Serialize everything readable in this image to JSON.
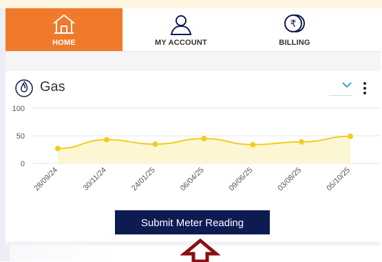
{
  "nav": {
    "tabs": [
      {
        "label": "HOME",
        "icon": "home-icon",
        "active": true
      },
      {
        "label": "MY ACCOUNT",
        "icon": "user-icon",
        "active": false
      },
      {
        "label": "BILLING",
        "icon": "rupee-icon",
        "active": false
      }
    ],
    "accent": "#f07a2a"
  },
  "card": {
    "title": "Gas",
    "icon": "flame-icon"
  },
  "chart_data": {
    "type": "area",
    "categories": [
      "28/09/24",
      "30/11/24",
      "24/01/25",
      "06/04/25",
      "09/06/25",
      "03/08/25",
      "05/10/25"
    ],
    "values": [
      27,
      43,
      35,
      45,
      34,
      39,
      49
    ],
    "ylim": [
      0,
      100
    ],
    "yticks": [
      0,
      50,
      100
    ],
    "line_color": "#f2cd1c",
    "fill_color": "#fdf6d2",
    "grid": true
  },
  "actions": {
    "submit_label": "Submit Meter Reading",
    "submit_color": "#0e1a52"
  },
  "indicator": {
    "icon": "up-arrow-icon",
    "color": "#8a0f0f"
  }
}
